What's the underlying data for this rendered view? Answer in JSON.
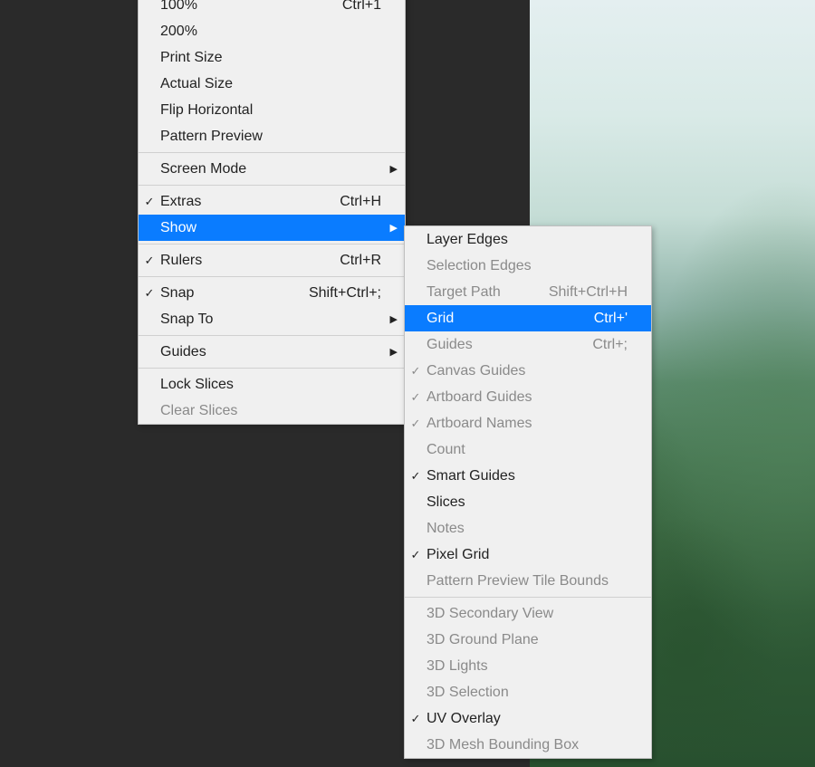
{
  "mainMenu": [
    {
      "type": "item",
      "label": "100%",
      "shortcut": "Ctrl+1"
    },
    {
      "type": "item",
      "label": "200%"
    },
    {
      "type": "item",
      "label": "Print Size"
    },
    {
      "type": "item",
      "label": "Actual Size"
    },
    {
      "type": "item",
      "label": "Flip Horizontal"
    },
    {
      "type": "item",
      "label": "Pattern Preview"
    },
    {
      "type": "divider"
    },
    {
      "type": "item",
      "label": "Screen Mode",
      "submenu": true
    },
    {
      "type": "divider"
    },
    {
      "type": "item",
      "label": "Extras",
      "shortcut": "Ctrl+H",
      "checked": true
    },
    {
      "type": "item",
      "label": "Show",
      "submenu": true,
      "highlighted": true
    },
    {
      "type": "divider"
    },
    {
      "type": "item",
      "label": "Rulers",
      "shortcut": "Ctrl+R",
      "checked": true
    },
    {
      "type": "divider"
    },
    {
      "type": "item",
      "label": "Snap",
      "shortcut": "Shift+Ctrl+;",
      "checked": true
    },
    {
      "type": "item",
      "label": "Snap To",
      "submenu": true
    },
    {
      "type": "divider"
    },
    {
      "type": "item",
      "label": "Guides",
      "submenu": true
    },
    {
      "type": "divider"
    },
    {
      "type": "item",
      "label": "Lock Slices"
    },
    {
      "type": "item",
      "label": "Clear Slices",
      "disabled": true
    }
  ],
  "subMenu": [
    {
      "type": "item",
      "label": "Layer Edges"
    },
    {
      "type": "item",
      "label": "Selection Edges",
      "disabled": true
    },
    {
      "type": "item",
      "label": "Target Path",
      "shortcut": "Shift+Ctrl+H",
      "disabled": true
    },
    {
      "type": "item",
      "label": "Grid",
      "shortcut": "Ctrl+'",
      "highlighted": true
    },
    {
      "type": "item",
      "label": "Guides",
      "shortcut": "Ctrl+;",
      "disabled": true
    },
    {
      "type": "item",
      "label": "Canvas Guides",
      "checked": true,
      "disabled": true
    },
    {
      "type": "item",
      "label": "Artboard Guides",
      "checked": true,
      "disabled": true
    },
    {
      "type": "item",
      "label": "Artboard Names",
      "checked": true,
      "disabled": true
    },
    {
      "type": "item",
      "label": "Count",
      "disabled": true
    },
    {
      "type": "item",
      "label": "Smart Guides",
      "checked": true
    },
    {
      "type": "item",
      "label": "Slices"
    },
    {
      "type": "item",
      "label": "Notes",
      "disabled": true
    },
    {
      "type": "item",
      "label": "Pixel Grid",
      "checked": true
    },
    {
      "type": "item",
      "label": "Pattern Preview Tile Bounds",
      "disabled": true
    },
    {
      "type": "divider"
    },
    {
      "type": "item",
      "label": "3D Secondary View",
      "disabled": true
    },
    {
      "type": "item",
      "label": "3D Ground Plane",
      "disabled": true
    },
    {
      "type": "item",
      "label": "3D Lights",
      "disabled": true
    },
    {
      "type": "item",
      "label": "3D Selection",
      "disabled": true
    },
    {
      "type": "item",
      "label": "UV Overlay",
      "checked": true
    },
    {
      "type": "item",
      "label": "3D Mesh Bounding Box",
      "disabled": true
    }
  ]
}
